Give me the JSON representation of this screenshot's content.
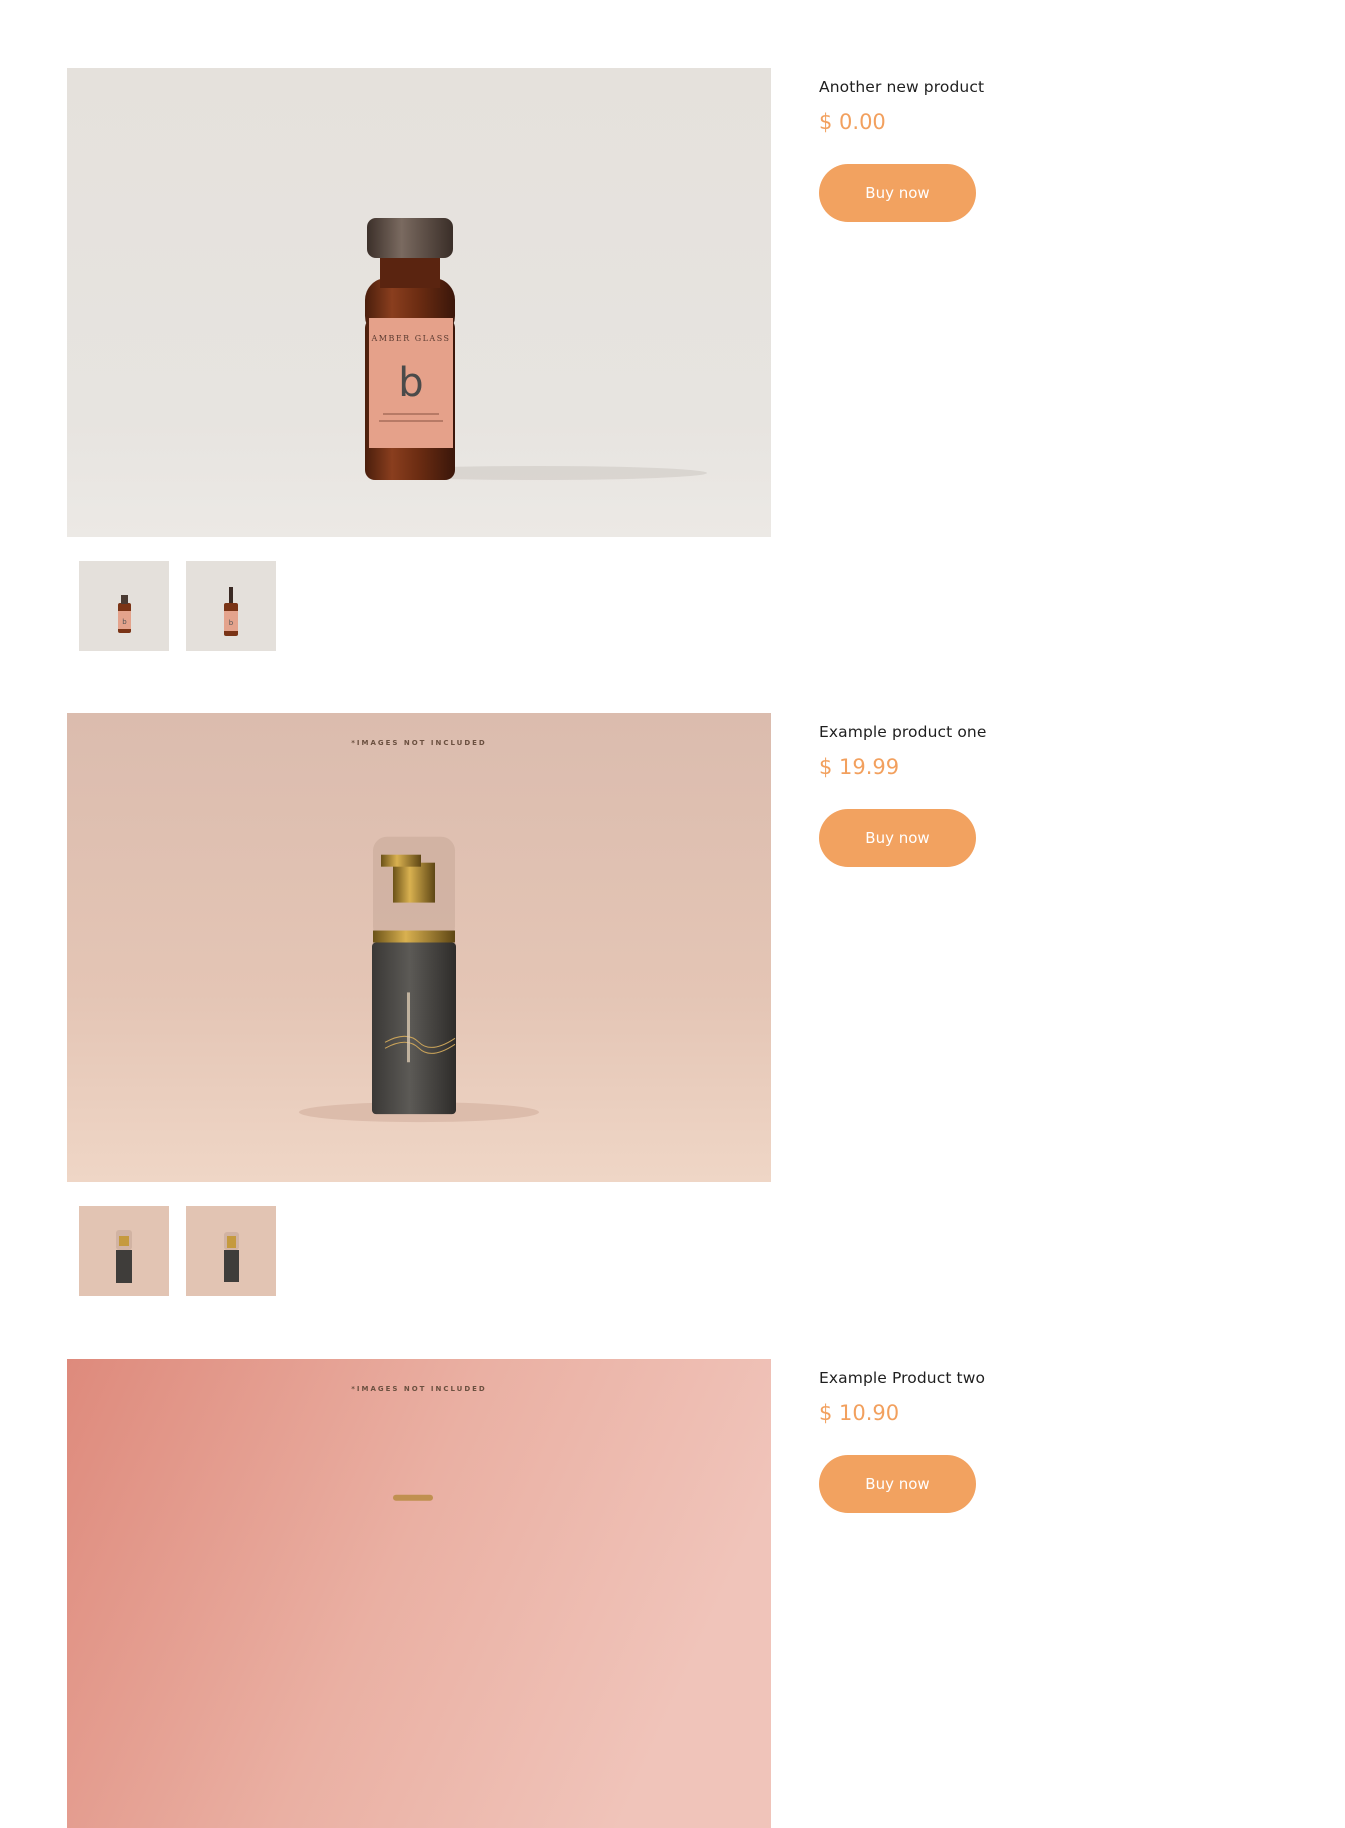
{
  "products": [
    {
      "title": "Another new product",
      "price": "$ 0.00",
      "buy_label": "Buy now",
      "image_note": "",
      "label_brand": "AMBER GLASS",
      "label_letter": "b"
    },
    {
      "title": "Example product one",
      "price": "$ 19.99",
      "buy_label": "Buy now",
      "image_note": "*IMAGES NOT INCLUDED"
    },
    {
      "title": "Example Product two",
      "price": "$ 10.90",
      "buy_label": "Buy now",
      "image_note": "*IMAGES NOT INCLUDED"
    }
  ],
  "colors": {
    "accent": "#f2a260",
    "price": "#f2a05e"
  }
}
